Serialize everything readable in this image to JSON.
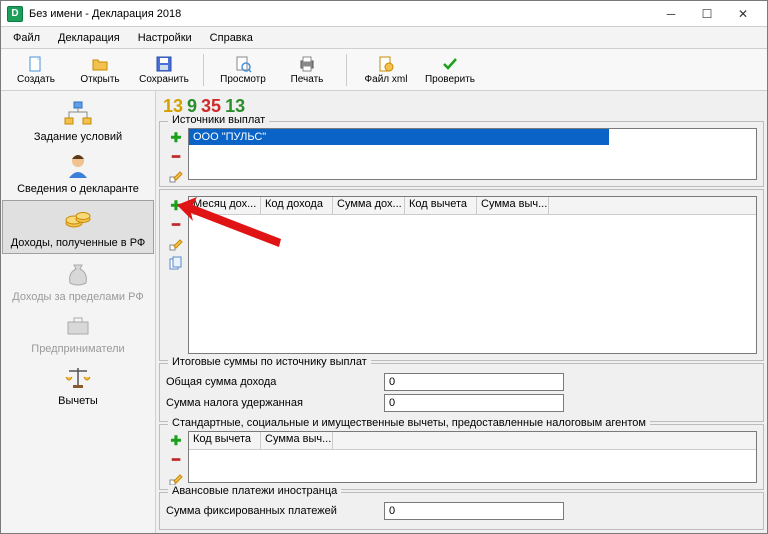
{
  "title": "Без имени - Декларация 2018",
  "menus": [
    "Файл",
    "Декларация",
    "Настройки",
    "Справка"
  ],
  "toolbar": {
    "create": "Создать",
    "open": "Открыть",
    "save": "Сохранить",
    "preview": "Просмотр",
    "print": "Печать",
    "filexml": "Файл xml",
    "check": "Проверить"
  },
  "digits": [
    "13",
    "9",
    "35",
    "13"
  ],
  "sidebar": {
    "conditions": "Задание условий",
    "declarant": "Сведения о декларанте",
    "income_rf": "Доходы, полученные в РФ",
    "income_abroad": "Доходы за пределами РФ",
    "entrepreneur": "Предприниматели",
    "deductions": "Вычеты"
  },
  "sources": {
    "title": "Источники выплат",
    "row1": "ООО \"ПУЛЬС\""
  },
  "income_table": {
    "cols": [
      "Месяц дох...",
      "Код дохода",
      "Сумма дох...",
      "Код вычета",
      "Сумма выч..."
    ]
  },
  "totals": {
    "title": "Итоговые суммы по источнику выплат",
    "total_income_label": "Общая сумма дохода",
    "total_income_value": "0",
    "tax_withheld_label": "Сумма налога удержанная",
    "tax_withheld_value": "0"
  },
  "agent_deductions": {
    "title": "Стандартные, социальные и имущественные вычеты, предоставленные налоговым агентом",
    "cols": [
      "Код вычета",
      "Сумма выч..."
    ]
  },
  "advance": {
    "title": "Авансовые платежи иностранца",
    "fixed_label": "Сумма фиксированных платежей",
    "fixed_value": "0"
  }
}
